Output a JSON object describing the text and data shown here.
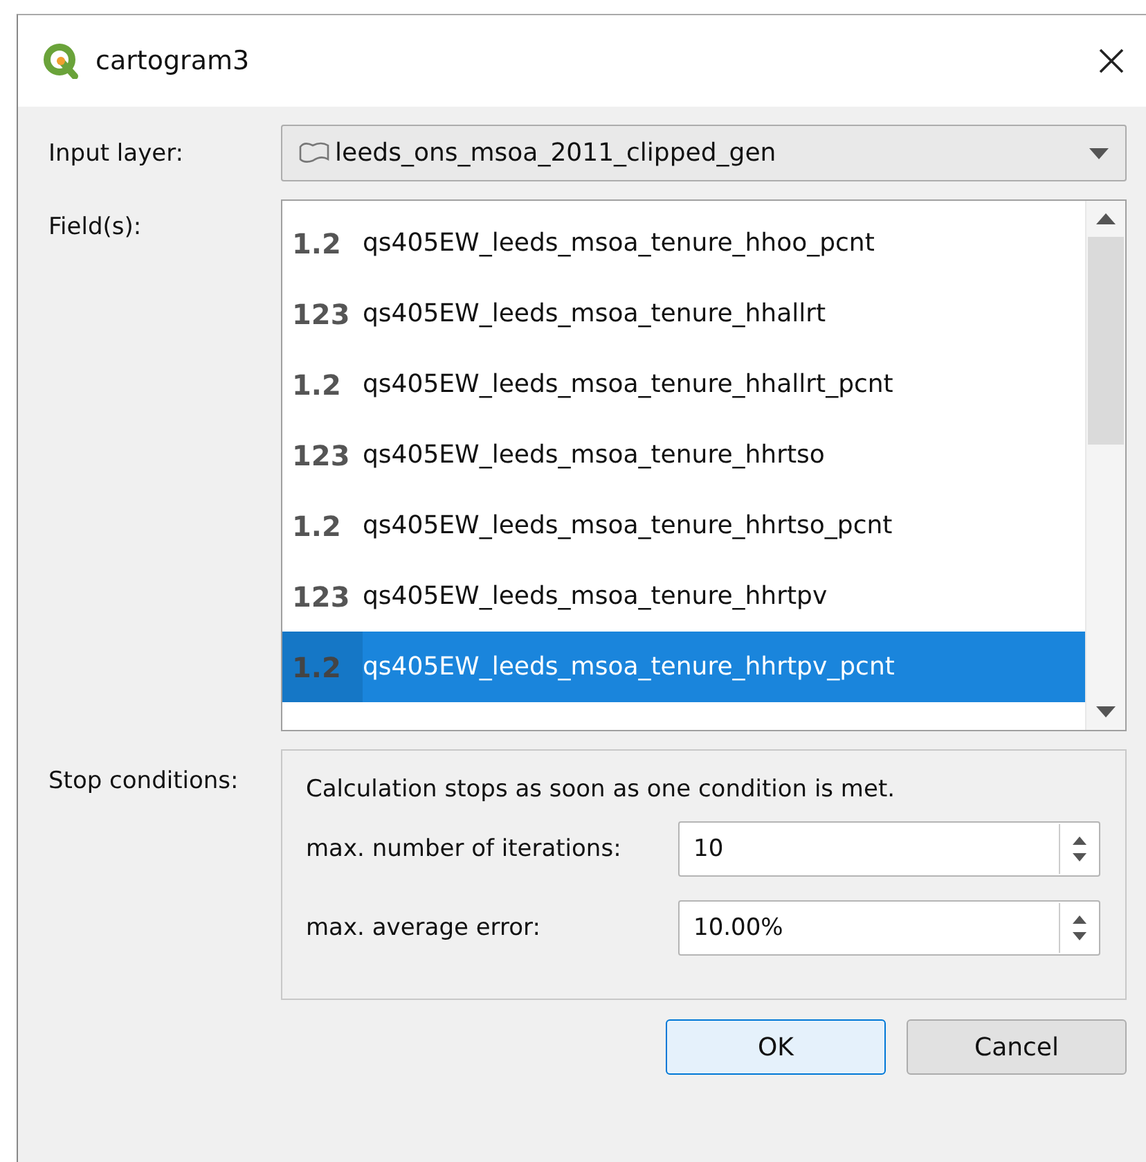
{
  "window": {
    "title": "cartogram3"
  },
  "input_layer": {
    "label": "Input layer:",
    "value": "leeds_ons_msoa_2011_clipped_gen"
  },
  "fields": {
    "label": "Field(s):",
    "items": [
      {
        "type_label": "1.2",
        "name": "qs405EW_leeds_msoa_tenure_hhoo_pcnt",
        "selected": false
      },
      {
        "type_label": "123",
        "name": "qs405EW_leeds_msoa_tenure_hhallrt",
        "selected": false
      },
      {
        "type_label": "1.2",
        "name": "qs405EW_leeds_msoa_tenure_hhallrt_pcnt",
        "selected": false
      },
      {
        "type_label": "123",
        "name": "qs405EW_leeds_msoa_tenure_hhrtso",
        "selected": false
      },
      {
        "type_label": "1.2",
        "name": "qs405EW_leeds_msoa_tenure_hhrtso_pcnt",
        "selected": false
      },
      {
        "type_label": "123",
        "name": "qs405EW_leeds_msoa_tenure_hhrtpv",
        "selected": false
      },
      {
        "type_label": "1.2",
        "name": "qs405EW_leeds_msoa_tenure_hhrtpv_pcnt",
        "selected": true
      }
    ]
  },
  "stop_conditions": {
    "label": "Stop conditions:",
    "note": "Calculation stops as soon as one condition is met.",
    "settings": [
      {
        "label": "max. number of iterations:",
        "value": "10"
      },
      {
        "label": "max. average error:",
        "value": "10.00%"
      }
    ]
  },
  "buttons": [
    {
      "label": "OK",
      "default": true
    },
    {
      "label": "Cancel",
      "default": false
    }
  ]
}
